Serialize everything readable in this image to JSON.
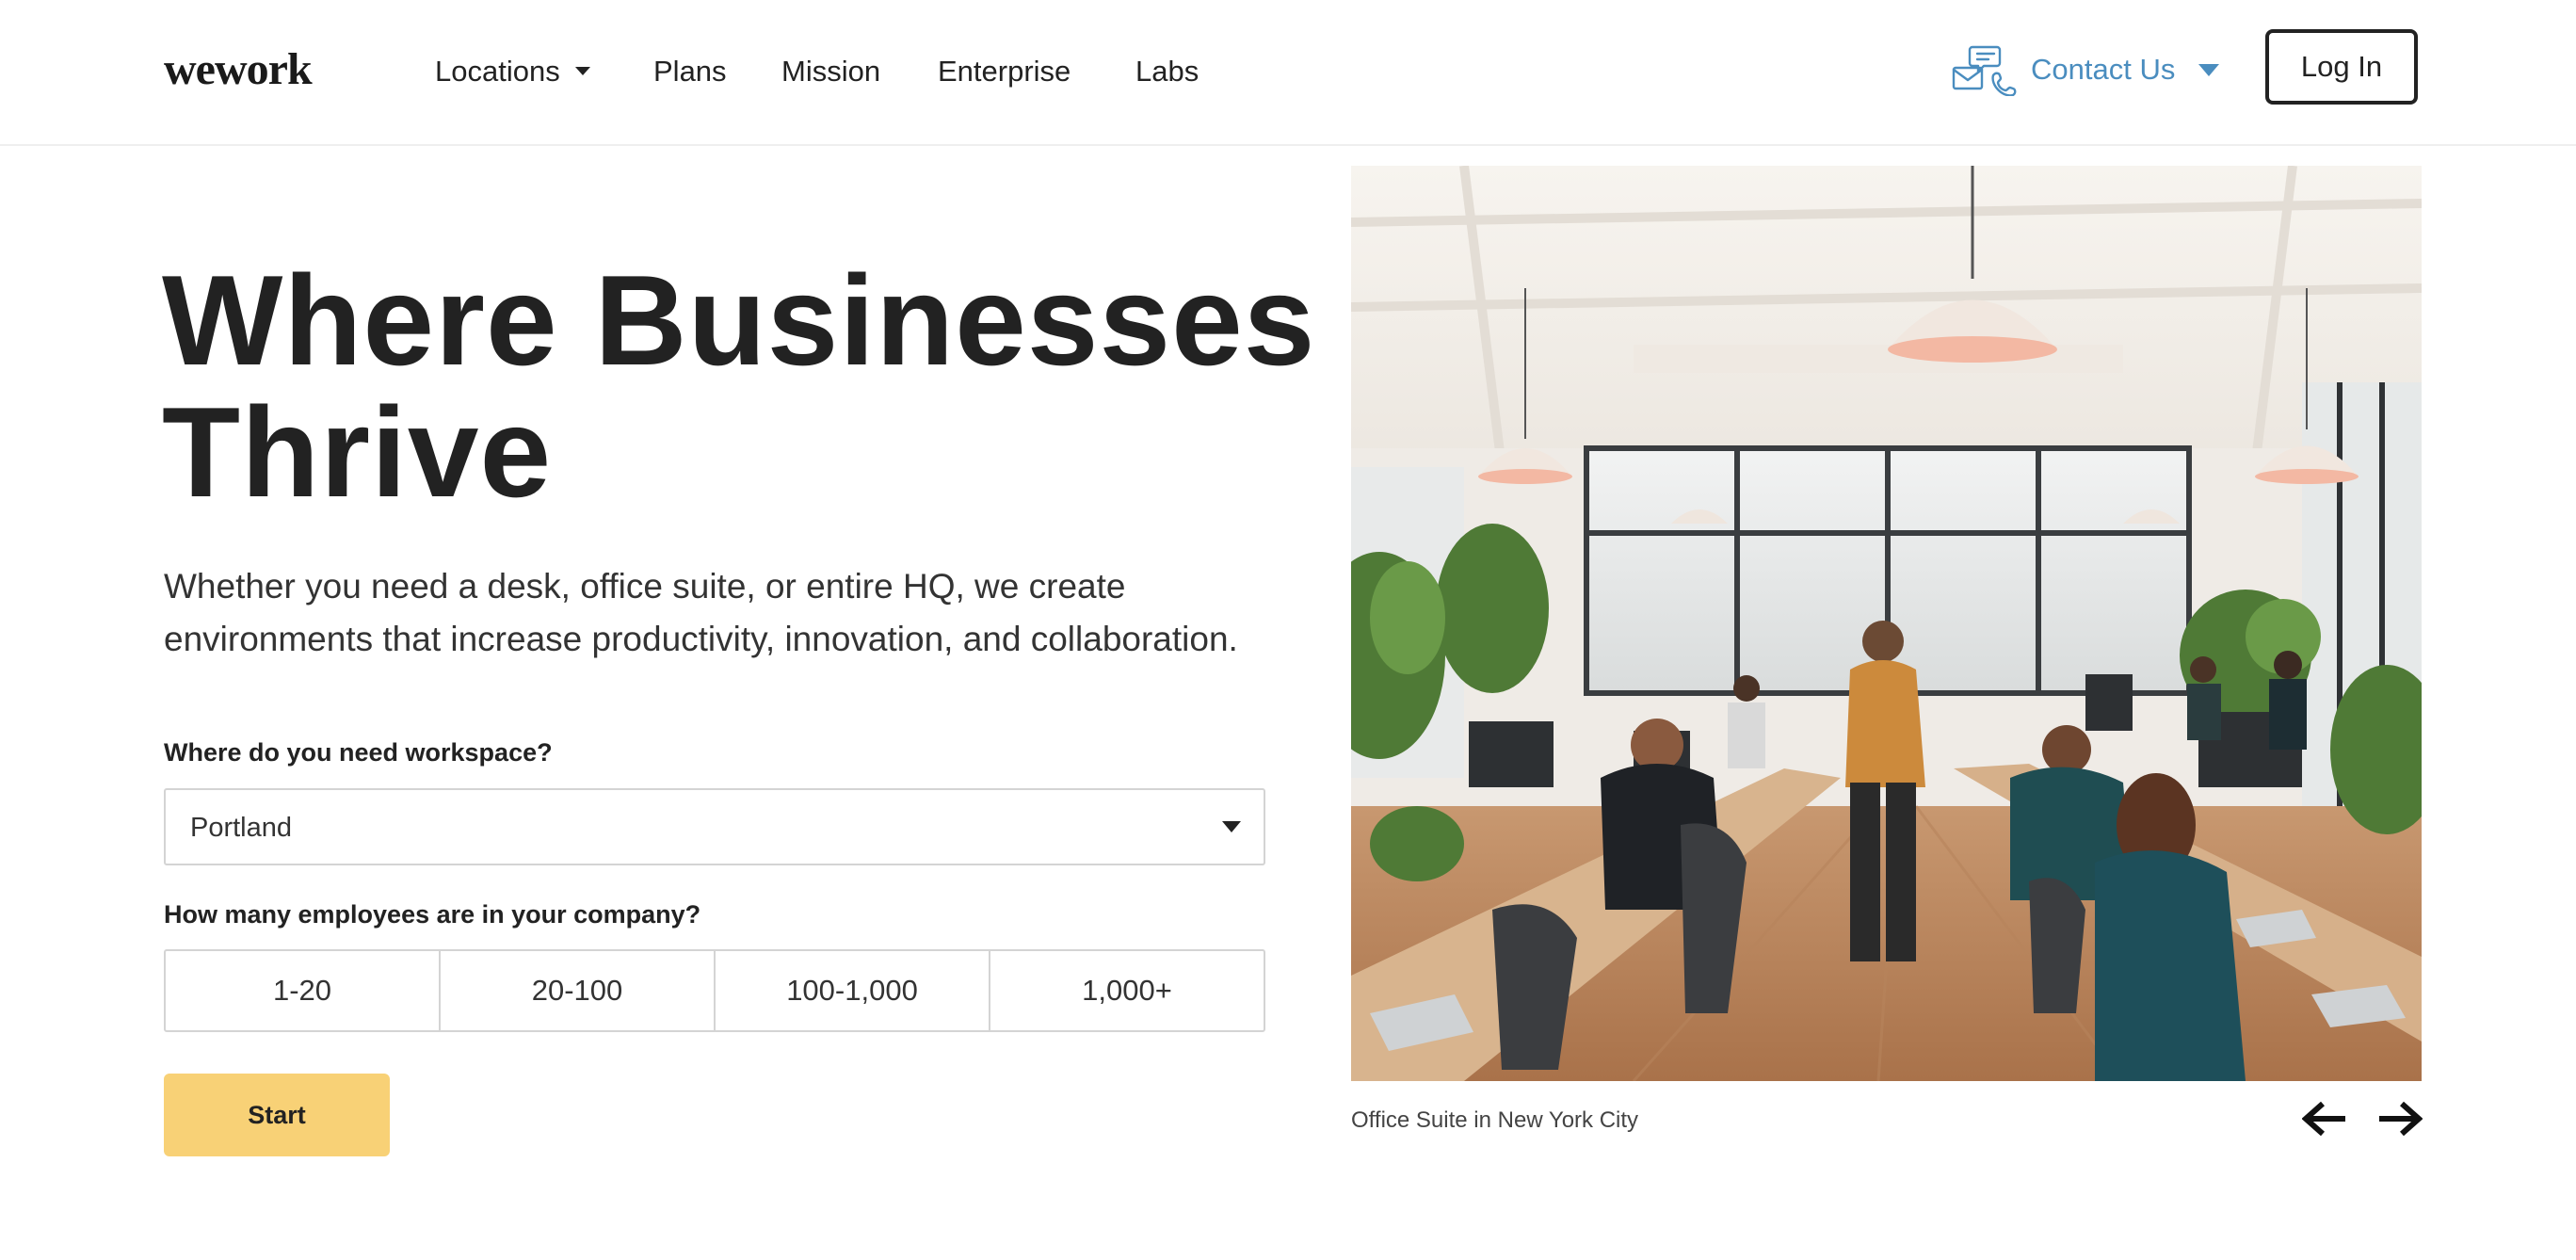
{
  "header": {
    "logo": "wework",
    "nav": {
      "locations": "Locations",
      "plans": "Plans",
      "mission": "Mission",
      "enterprise": "Enterprise",
      "labs": "Labs"
    },
    "contact_label": "Contact Us",
    "login_label": "Log In",
    "contact_color": "#4a8dbf"
  },
  "hero": {
    "headline_line1": "Where Businesses",
    "headline_line2": "Thrive",
    "subtext": "Whether you need a desk, office suite, or entire HQ, we create environments that increase productivity, innovation, and collaboration.",
    "workspace_label": "Where do you need workspace?",
    "workspace_value": "Portland",
    "employees_label": "How many employees are in your company?",
    "employee_options": [
      "1-20",
      "20-100",
      "100-1,000",
      "1,000+"
    ],
    "start_label": "Start",
    "start_color": "#f8d176"
  },
  "carousel": {
    "caption": "Office Suite in New York City",
    "prev_icon": "arrow-left-icon",
    "next_icon": "arrow-right-icon"
  }
}
